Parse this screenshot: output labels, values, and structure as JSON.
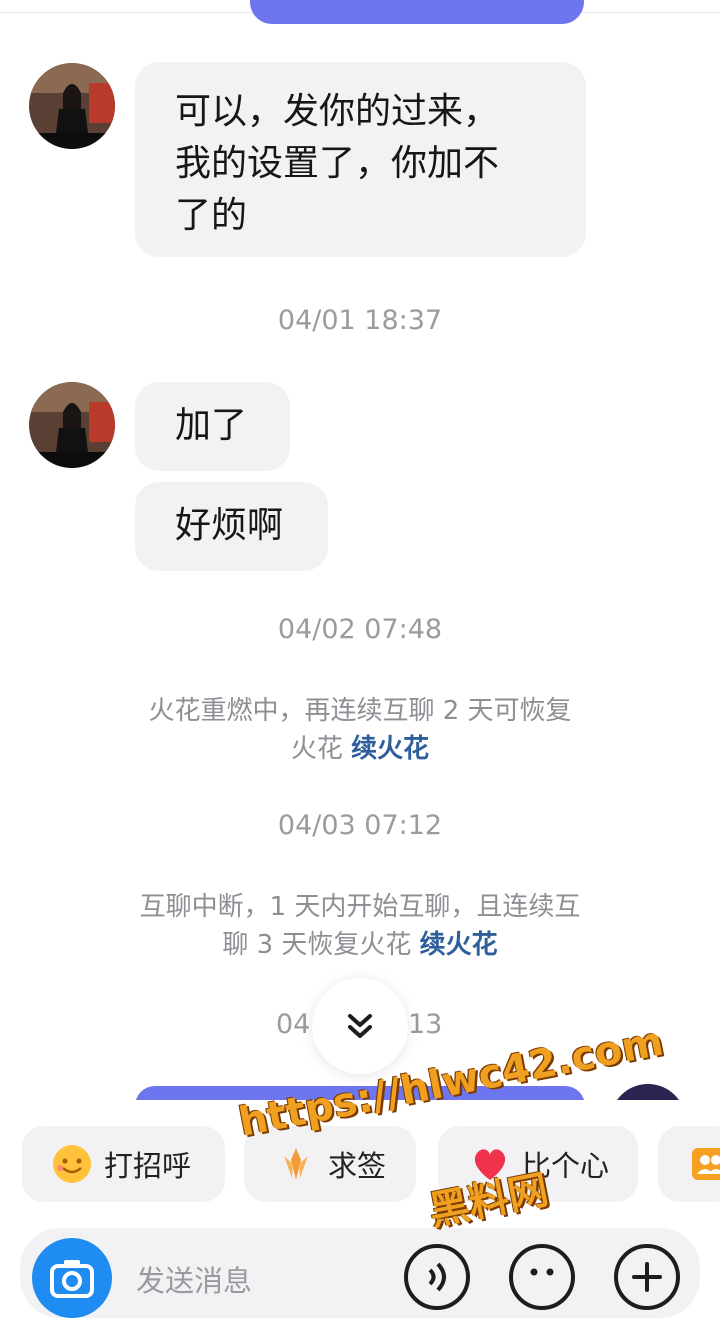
{
  "messages": [
    {
      "text_lines": [
        "可以，发你的过来，",
        "我的设置了，你加不",
        "了的"
      ]
    },
    {
      "text": "加了"
    },
    {
      "text": "好烦啊"
    }
  ],
  "timestamps": [
    "04/01 18:37",
    "04/02 07:48",
    "04/03 07:12",
    "04",
    "13"
  ],
  "system_notices": [
    {
      "line1": "火花重燃中，再连续互聊 2 天可恢复",
      "line2_text": "火花 ",
      "link": "续火花"
    },
    {
      "line1": "互聊中断，1 天内开始互聊，且连续互",
      "line2_text": "聊 3 天恢复火花 ",
      "link": "续火花"
    }
  ],
  "quick_actions": [
    {
      "label": "打招呼",
      "icon": "smile-emoji-icon"
    },
    {
      "label": "求签",
      "icon": "fortune-icon"
    },
    {
      "label": "比个心",
      "icon": "heart-icon"
    },
    {
      "label": "",
      "icon": "people-icon"
    }
  ],
  "input": {
    "placeholder": "发送消息"
  },
  "watermark": {
    "line1": "https://hlwc42.com",
    "line2": "黑料网"
  },
  "colors": {
    "accent": "#6d76ef",
    "link": "#2f5f9b",
    "bubble": "#f2f2f4",
    "camera": "#1e8cf0"
  }
}
